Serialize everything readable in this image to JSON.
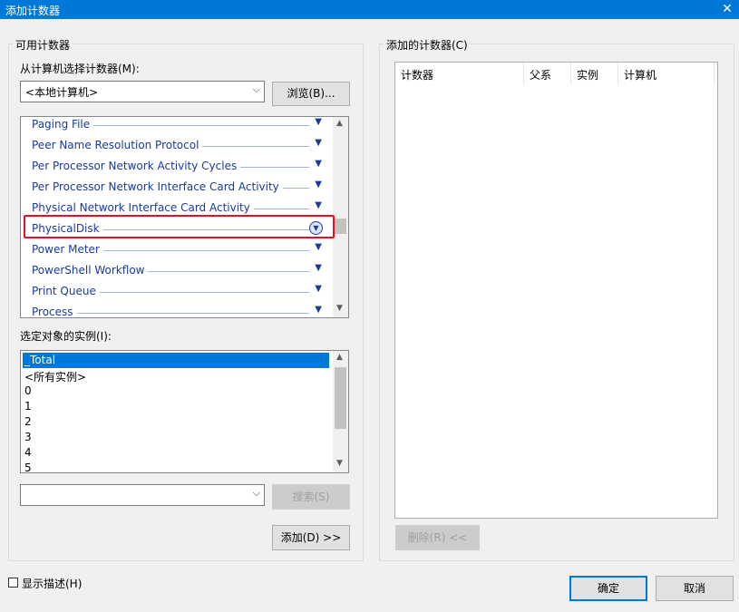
{
  "window": {
    "title": "添加计数器",
    "close_glyph": "✕"
  },
  "available": {
    "group_label": "可用计数器",
    "select_label": "从计算机选择计数器(M):",
    "computer_value": "<本地计算机>",
    "browse_label": "浏览(B)...",
    "objects": [
      "Paging File",
      "Peer Name Resolution Protocol",
      "Per Processor Network Activity Cycles",
      "Per Processor Network Interface Card Activity",
      "Physical Network Interface Card Activity",
      "PhysicalDisk",
      "Power Meter",
      "PowerShell Workflow",
      "Print Queue",
      "Process"
    ],
    "highlighted_object": "PhysicalDisk",
    "instances_label": "选定对象的实例(I):",
    "instances": [
      "_Total",
      "<所有实例>",
      "0",
      "1",
      "2",
      "3",
      "4",
      "5"
    ],
    "selected_instance": "_Total",
    "search_value": "",
    "search_label": "搜索(S)",
    "add_label": "添加(D) >>"
  },
  "added": {
    "group_label": "添加的计数器(C)",
    "columns": [
      "计数器",
      "父系",
      "实例",
      "计算机"
    ],
    "remove_label": "删除(R) <<"
  },
  "footer": {
    "show_desc_label": "显示描述(H)",
    "show_desc_checked": false,
    "ok_label": "确定",
    "cancel_label": "取消"
  },
  "colors": {
    "accent": "#0078d7",
    "highlight_box": "#e81123",
    "link_text": "#1a3a9c"
  }
}
